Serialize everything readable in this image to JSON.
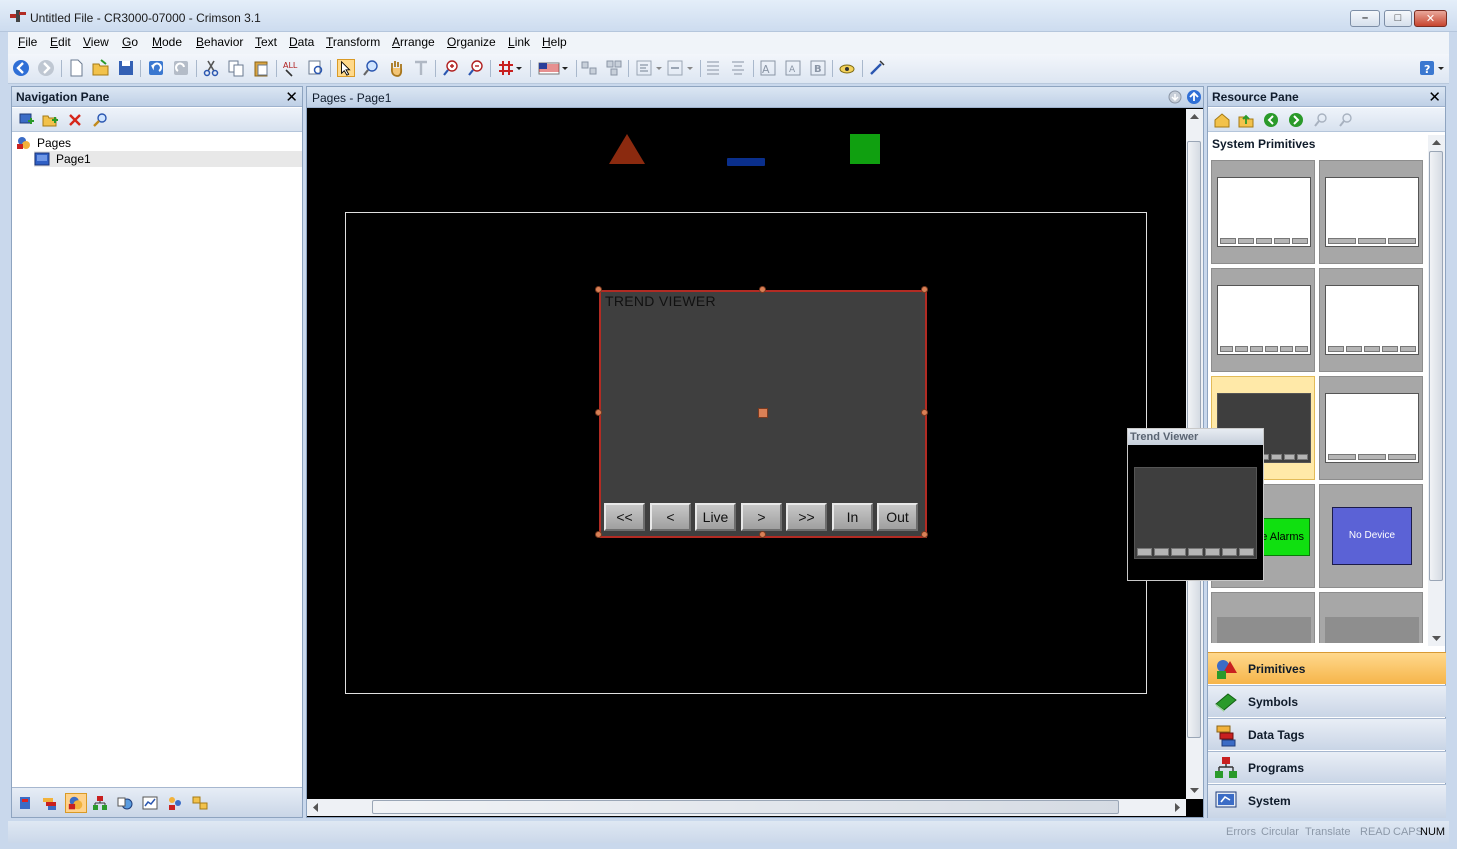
{
  "window": {
    "title": "Untitled File - CR3000-07000 - Crimson 3.1",
    "minimize_glyph": "–",
    "maximize_glyph": "□",
    "close_glyph": "✕"
  },
  "menu": [
    "File",
    "Edit",
    "View",
    "Go",
    "Mode",
    "Behavior",
    "Text",
    "Data",
    "Transform",
    "Arrange",
    "Organize",
    "Link",
    "Help"
  ],
  "navigation_pane": {
    "title": "Navigation Pane",
    "close_glyph": "✕",
    "tree": {
      "root": "Pages",
      "children": [
        "Page1"
      ]
    }
  },
  "editor": {
    "title": "Pages - Page1",
    "trend_viewer": {
      "title": "TREND VIEWER",
      "buttons": [
        "<<",
        "<",
        "Live",
        ">",
        ">>",
        "In",
        "Out"
      ]
    },
    "colors": {
      "triangle": "#8b2a0f",
      "bar": "#0a2f8c",
      "square": "#10a010"
    }
  },
  "resource_pane": {
    "title": "Resource Pane",
    "close_glyph": "✕",
    "section_label": "System Primitives",
    "tile_labels": {
      "alarms": "e Alarms",
      "no_device": "No Device"
    },
    "tooltip_title": "Trend Viewer",
    "categories": [
      "Primitives",
      "Symbols",
      "Data Tags",
      "Programs",
      "System"
    ]
  },
  "status": {
    "items": [
      "Errors",
      "Circular",
      "Translate",
      "READ",
      "CAPS",
      "NUM"
    ],
    "active": "NUM"
  }
}
